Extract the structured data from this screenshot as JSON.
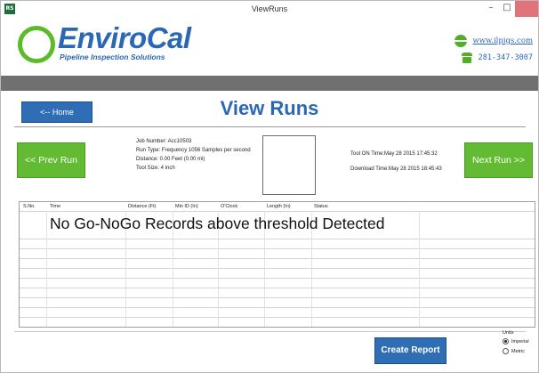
{
  "window": {
    "app_icon_text": "RS",
    "title": "ViewRuns",
    "controls": {
      "minimize": "–",
      "maximize": "□",
      "close": ""
    }
  },
  "brand": {
    "name_part1": "Enviro",
    "name_part2": "Cal",
    "tagline": "Pipeline Inspection Solutions",
    "website": "www.ilpigs.com",
    "phone": "281-347-3007",
    "colors": {
      "blue": "#2a67b5",
      "green": "#5dbb2a",
      "band": "#707070"
    }
  },
  "nav": {
    "home_label": "<-- Home",
    "page_title": "View Runs",
    "prev_label": "<< Prev Run",
    "next_label": "Next Run >>"
  },
  "run": {
    "job_number": "Job Number: Acc10503",
    "run_type": "Run Type: Frequency 1056 Samples per second",
    "distance": "Distance: 0.00 Feet  (0.00 mi)",
    "tool_size": "Tool Size: 4 inch",
    "tool_on_time": "Tool ON Time:May 28 2015 17:45:32",
    "download_time": "Download Time:May 28 2015 18:45:43"
  },
  "table": {
    "columns": [
      "S.No.",
      "Time",
      "Distance (Ft)",
      "Min ID (In)",
      "O'Clock",
      "Length (In)",
      "Status"
    ],
    "message": "No Go-NoGo Records above threshold Detected",
    "rows": []
  },
  "footer": {
    "create_report_label": "Create Report",
    "units_label": "Units",
    "unit_options": [
      "Imperial",
      "Metric"
    ],
    "selected_unit": "Imperial"
  }
}
